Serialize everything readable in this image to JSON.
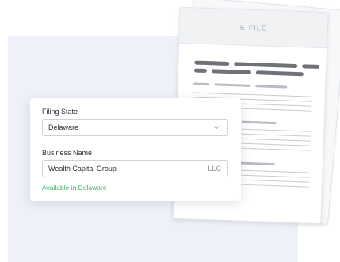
{
  "document": {
    "title": "E-FILE"
  },
  "form": {
    "filing_state": {
      "label": "Filing State",
      "selected": "Delaware"
    },
    "business_name": {
      "label": "Business Name",
      "value": "Wealth Capital Group",
      "suffix": "LLC"
    },
    "availability": "Available in Delaware"
  },
  "colors": {
    "background_panel": "#eef1f9",
    "success": "#3fb36b",
    "dark_line": "#6f7378"
  },
  "icons": {
    "dropdown": "chevron-down-icon"
  }
}
